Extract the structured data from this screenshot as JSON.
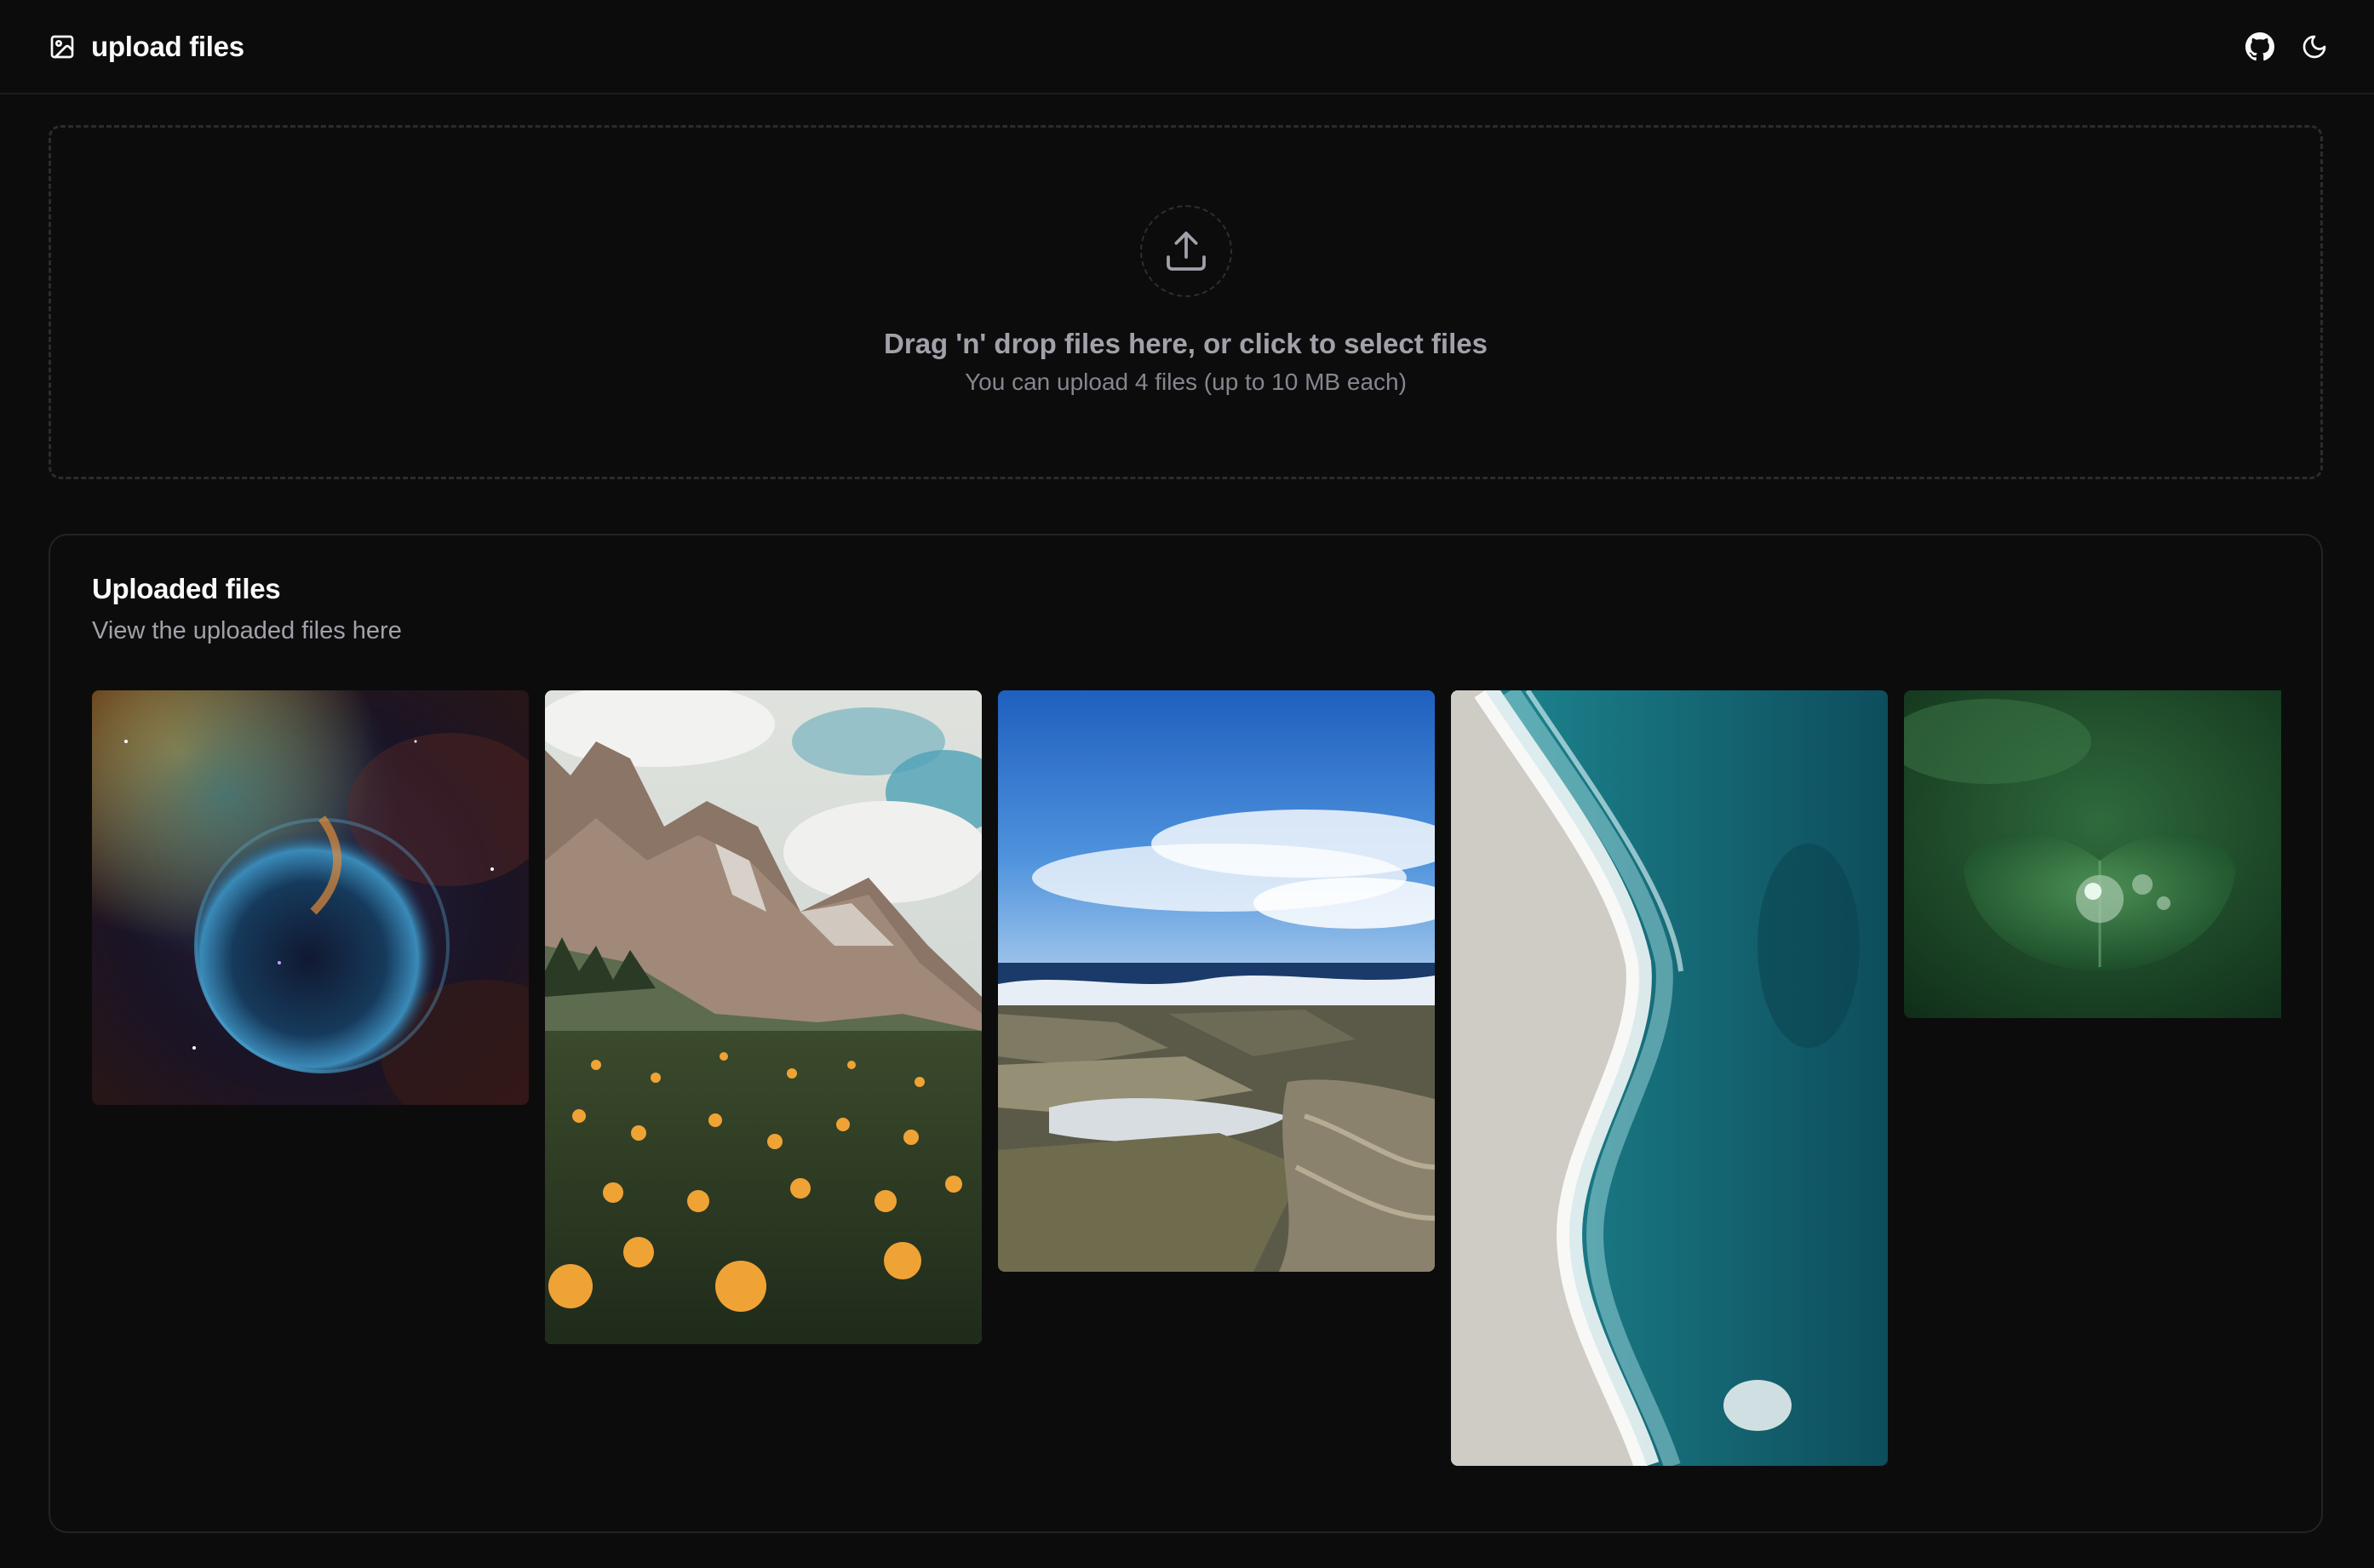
{
  "header": {
    "title": "upload files",
    "brand_icon": "image-icon",
    "actions": [
      {
        "name": "github-icon"
      },
      {
        "name": "moon-icon"
      }
    ]
  },
  "dropzone": {
    "icon": "upload-icon",
    "title": "Drag 'n' drop files here, or click to select files",
    "subtitle": "You can upload 4 files (up to 10 MB each)"
  },
  "uploaded": {
    "title": "Uploaded files",
    "description": "View the uploaded files here",
    "images": [
      {
        "subject": "bubble nebula in space"
      },
      {
        "subject": "mountain meadow with orange flowers"
      },
      {
        "subject": "rocky coastline under blue sky"
      },
      {
        "subject": "aerial view of ocean waves on beach"
      },
      {
        "subject": "water droplet on green leaf"
      }
    ]
  },
  "colors": {
    "background": "#0c0c0d",
    "border": "#232326",
    "text_primary": "#fafafa",
    "text_muted": "#a1a1aa"
  }
}
